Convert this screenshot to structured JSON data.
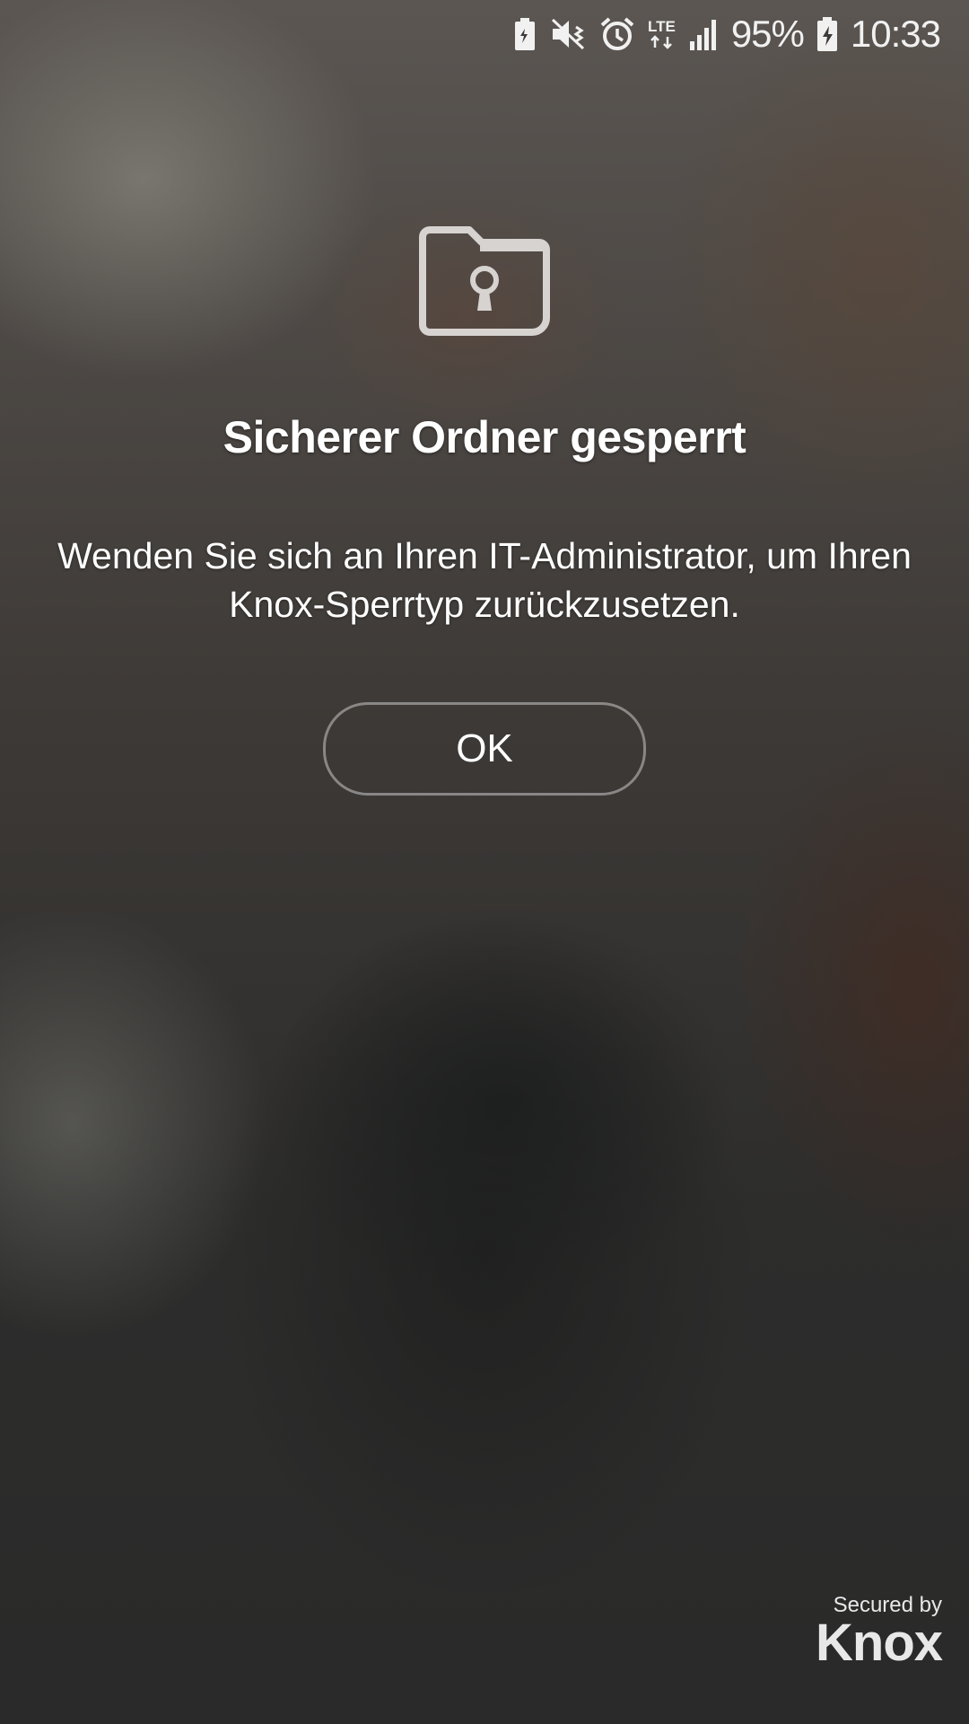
{
  "status_bar": {
    "icons": [
      "battery-saver-icon",
      "mute-icon",
      "alarm-icon",
      "lte-icon",
      "signal-icon",
      "battery-charging-icon"
    ],
    "lte_label": "LTE",
    "battery_percent": "95%",
    "time": "10:33"
  },
  "lock_screen": {
    "icon": "secure-folder-lock-icon",
    "title": "Sicherer Ordner gesperrt",
    "message": "Wenden Sie sich an Ihren IT-Administrator, um Ihren Knox-Sperrtyp zurückzusetzen.",
    "ok_label": "OK"
  },
  "branding": {
    "secured_by": "Secured by",
    "logo": "Knox"
  }
}
